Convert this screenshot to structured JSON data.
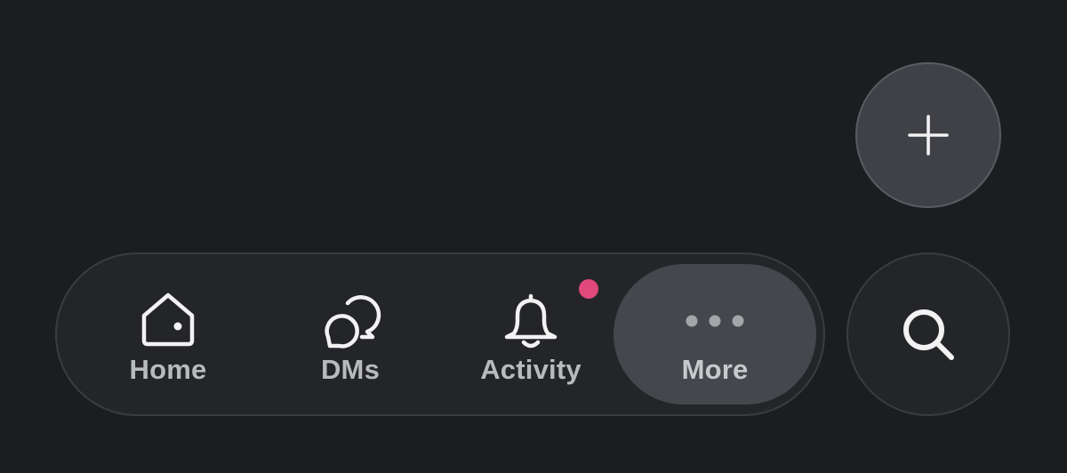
{
  "colors": {
    "background": "#1b1d21",
    "tabbar": "#242529",
    "selected_tab": "#45474c",
    "fab": "#3f4146",
    "icon": "#f2f2f3",
    "label": "#b9babd",
    "badge": "#e0497b"
  },
  "compose_button": {
    "icon": "plus-icon"
  },
  "tabbar": {
    "tabs": [
      {
        "label": "Home",
        "icon": "home-icon",
        "selected": false,
        "badge": false
      },
      {
        "label": "DMs",
        "icon": "chat-bubbles-icon",
        "selected": false,
        "badge": false
      },
      {
        "label": "Activity",
        "icon": "bell-icon",
        "selected": false,
        "badge": true
      },
      {
        "label": "More",
        "icon": "more-dots-icon",
        "selected": true,
        "badge": false
      }
    ]
  },
  "search_button": {
    "icon": "search-icon"
  }
}
